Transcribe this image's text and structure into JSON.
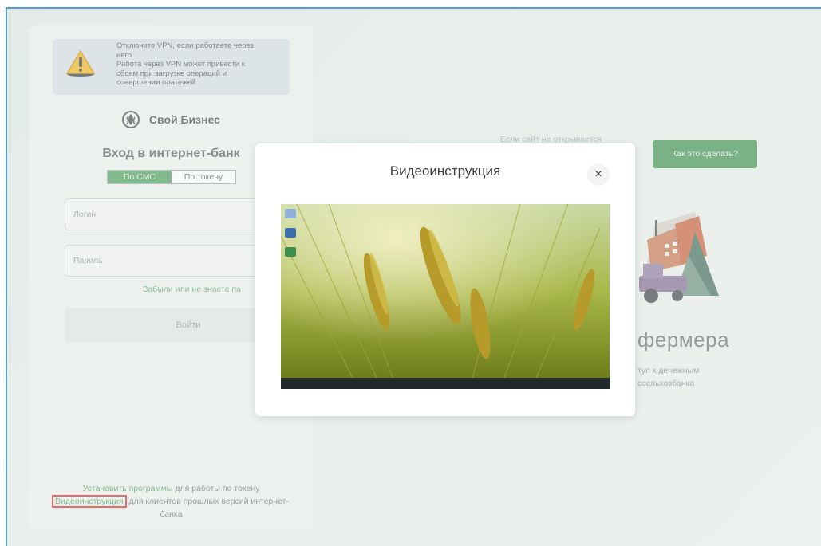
{
  "vpn_alert": {
    "line1": "Отключите VPN, если работаете через",
    "line2": "него",
    "line3": "Работа через VPN может привести к",
    "line4": "сбоям при загрузке операций и",
    "line5": "совершении платежей"
  },
  "brand": {
    "name": "Свой Бизнес"
  },
  "login": {
    "title": "Вход в интернет-банк",
    "tabs": [
      "По СМС",
      "По токену"
    ],
    "login_placeholder": "Логин",
    "password_placeholder": "Пароль",
    "forgot_link": "Забыли или не знаете па",
    "submit_label": "Войти"
  },
  "footer": {
    "install_link": "Установить программы",
    "install_rest": " для работы по токену",
    "video_link": "Видеоинструкция",
    "video_rest": " для клиентов прошлых версий интернет-",
    "video_rest2": "банка"
  },
  "background": {
    "site_hint": "Если сайт не открывается",
    "how_button": "Как это сделать?",
    "farmer_title": "фермера",
    "farmer_sub1": "туп к денежным",
    "farmer_sub2": "ссельхозбанка"
  },
  "modal": {
    "title": "Видеоинструкция",
    "close_symbol": "×"
  },
  "colors": {
    "accent_green": "#4d9b5b",
    "button_green": "#3e8f4d",
    "highlight_red": "#e02424"
  }
}
